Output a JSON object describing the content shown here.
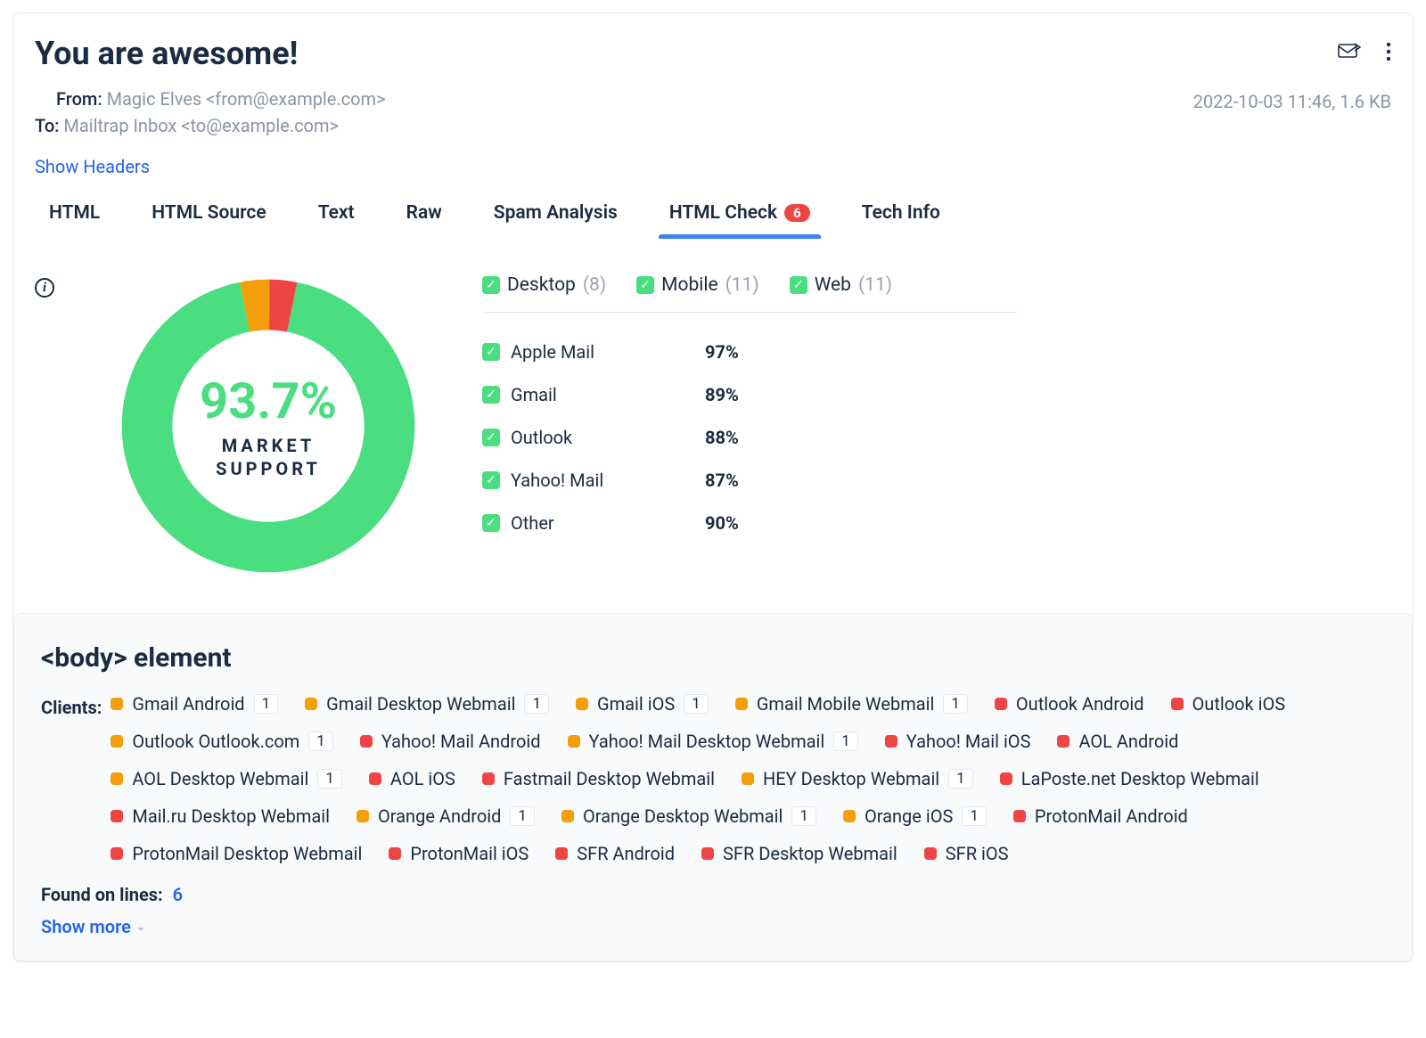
{
  "header": {
    "title": "You are awesome!",
    "from_label": "From:",
    "from_value": "Magic Elves <from@example.com>",
    "to_label": "To:",
    "to_value": "Mailtrap Inbox <to@example.com>",
    "timestamp": "2022-10-03 11:46, 1.6 KB",
    "show_headers": "Show Headers"
  },
  "tabs": [
    {
      "label": "HTML"
    },
    {
      "label": "HTML Source"
    },
    {
      "label": "Text"
    },
    {
      "label": "Raw"
    },
    {
      "label": "Spam Analysis"
    },
    {
      "label": "HTML Check",
      "badge": "6",
      "active": true
    },
    {
      "label": "Tech Info"
    }
  ],
  "chart_data": {
    "type": "pie",
    "title": "MARKET SUPPORT",
    "center_value": "93.7%",
    "slices": [
      {
        "name": "supported",
        "value": 93.7,
        "color": "#4ade80"
      },
      {
        "name": "partial",
        "value": 3.3,
        "color": "#f59e0b"
      },
      {
        "name": "unsupported",
        "value": 3.0,
        "color": "#ef4444"
      }
    ],
    "label_line1": "MARKET",
    "label_line2": "SUPPORT"
  },
  "filters": [
    {
      "label": "Desktop",
      "count": "(8)"
    },
    {
      "label": "Mobile",
      "count": "(11)"
    },
    {
      "label": "Web",
      "count": "(11)"
    }
  ],
  "clients_summary": [
    {
      "name": "Apple Mail",
      "pct": "97%"
    },
    {
      "name": "Gmail",
      "pct": "89%"
    },
    {
      "name": "Outlook",
      "pct": "88%"
    },
    {
      "name": "Yahoo! Mail",
      "pct": "87%"
    },
    {
      "name": "Other",
      "pct": "90%"
    }
  ],
  "issue_panel": {
    "title": "<body> element",
    "clients_label": "Clients:",
    "clients": [
      {
        "name": "Gmail Android",
        "color": "orange",
        "count": "1"
      },
      {
        "name": "Gmail Desktop Webmail",
        "color": "orange",
        "count": "1"
      },
      {
        "name": "Gmail iOS",
        "color": "orange",
        "count": "1"
      },
      {
        "name": "Gmail Mobile Webmail",
        "color": "orange",
        "count": "1"
      },
      {
        "name": "Outlook Android",
        "color": "red"
      },
      {
        "name": "Outlook iOS",
        "color": "red"
      },
      {
        "name": "Outlook Outlook.com",
        "color": "orange",
        "count": "1"
      },
      {
        "name": "Yahoo! Mail Android",
        "color": "red"
      },
      {
        "name": "Yahoo! Mail Desktop Webmail",
        "color": "orange",
        "count": "1"
      },
      {
        "name": "Yahoo! Mail iOS",
        "color": "red"
      },
      {
        "name": "AOL Android",
        "color": "red"
      },
      {
        "name": "AOL Desktop Webmail",
        "color": "orange",
        "count": "1"
      },
      {
        "name": "AOL iOS",
        "color": "red"
      },
      {
        "name": "Fastmail Desktop Webmail",
        "color": "red"
      },
      {
        "name": "HEY Desktop Webmail",
        "color": "orange",
        "count": "1"
      },
      {
        "name": "LaPoste.net Desktop Webmail",
        "color": "red"
      },
      {
        "name": "Mail.ru Desktop Webmail",
        "color": "red"
      },
      {
        "name": "Orange Android",
        "color": "orange",
        "count": "1"
      },
      {
        "name": "Orange Desktop Webmail",
        "color": "orange",
        "count": "1"
      },
      {
        "name": "Orange iOS",
        "color": "orange",
        "count": "1"
      },
      {
        "name": "ProtonMail Android",
        "color": "red"
      },
      {
        "name": "ProtonMail Desktop Webmail",
        "color": "red"
      },
      {
        "name": "ProtonMail iOS",
        "color": "red"
      },
      {
        "name": "SFR Android",
        "color": "red"
      },
      {
        "name": "SFR Desktop Webmail",
        "color": "red"
      },
      {
        "name": "SFR iOS",
        "color": "red"
      }
    ],
    "found_label": "Found on lines:",
    "found_value": "6",
    "show_more": "Show more"
  }
}
